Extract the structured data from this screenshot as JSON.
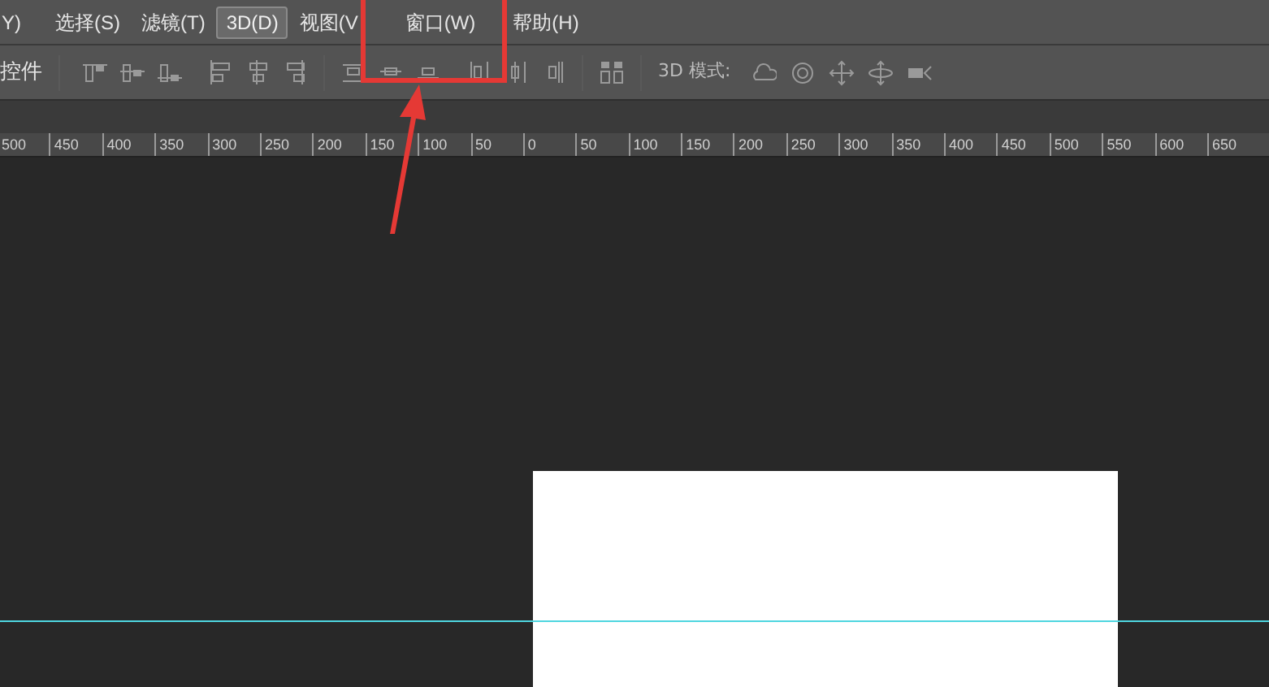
{
  "menu_bar": {
    "items": [
      {
        "label": "Y)",
        "selected": false
      },
      {
        "label": "选择(S)",
        "selected": false
      },
      {
        "label": "滤镜(T)",
        "selected": false
      },
      {
        "label": "3D(D)",
        "selected": true
      },
      {
        "label": "视图(V",
        "selected": false
      },
      {
        "label": "窗口(W)",
        "selected": false
      },
      {
        "label": "帮助(H)",
        "selected": false
      }
    ]
  },
  "options_bar": {
    "label": "控件",
    "mode_label": "3D 模式:"
  },
  "ruler": {
    "labels": [
      "500",
      "450",
      "400",
      "350",
      "300",
      "250",
      "200",
      "150",
      "100",
      "50",
      "0",
      "50",
      "100",
      "150",
      "200",
      "250",
      "300",
      "350",
      "400",
      "450",
      "500",
      "550",
      "600",
      "650"
    ]
  }
}
